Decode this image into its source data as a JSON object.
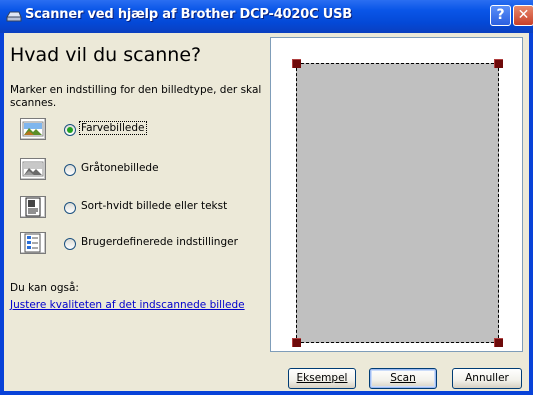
{
  "window": {
    "title": "Scanner ved hjælp af Brother DCP-4020C USB",
    "help_glyph": "?",
    "close_glyph": "✕"
  },
  "main": {
    "heading": "Hvad vil du scanne?",
    "description": "Marker en indstilling for den billedtype, der skal scannes.",
    "options": [
      {
        "label": "Farvebillede",
        "icon": "color-photo-icon",
        "selected": true
      },
      {
        "label": "Gråtonebillede",
        "icon": "grayscale-photo-icon",
        "selected": false
      },
      {
        "label": "Sort-hvidt billede eller tekst",
        "icon": "bw-text-icon",
        "selected": false
      },
      {
        "label": "Brugerdefinerede indstillinger",
        "icon": "custom-settings-icon",
        "selected": false
      }
    ],
    "also_label": "Du kan også:",
    "quality_link": "Justere kvaliteten af det indscannede billede"
  },
  "buttons": {
    "preview": "Eksempel",
    "scan": "Scan",
    "cancel": "Annuller"
  },
  "colors": {
    "title_bar": "#0a56e8",
    "dialog_bg": "#ece9d8",
    "scan_area": "#c0c0c0",
    "handle": "#6e0a0a",
    "link": "#0000cc"
  }
}
